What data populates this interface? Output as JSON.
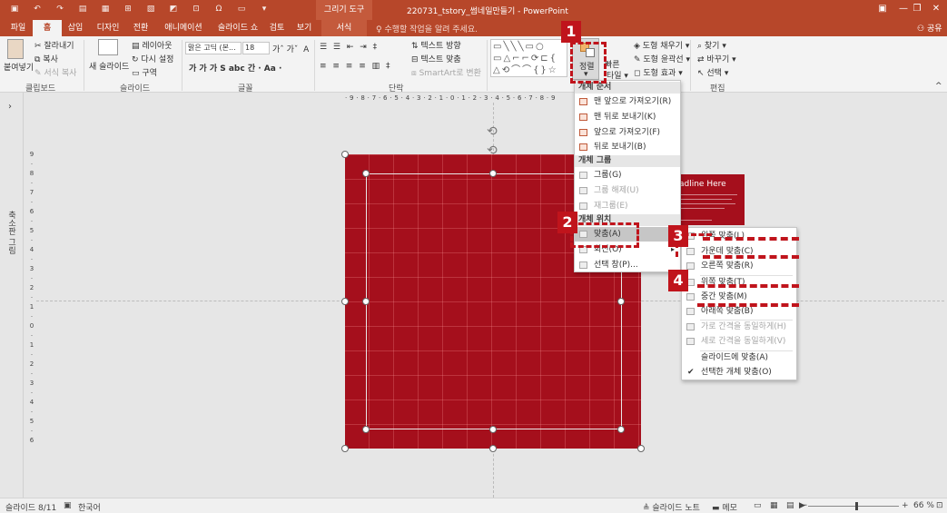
{
  "titlebar": {
    "context_tab": "그리기 도구",
    "doc_title": "220731_tstory_썸네일만들기 - PowerPoint",
    "qat_icons": [
      "save-icon",
      "undo-icon",
      "redo-icon",
      "slideshow-icon",
      "grid-icon",
      "table-icon",
      "picture-icon",
      "shape-icon",
      "symbol-icon",
      "omega-icon",
      "textbox-icon",
      "more-icon"
    ]
  },
  "tabs": [
    "파일",
    "홈",
    "삽입",
    "디자인",
    "전환",
    "애니메이션",
    "슬라이드 쇼",
    "검토",
    "보기",
    "서식"
  ],
  "active_tab": "홈",
  "tell_me": "수행할 작업을 알려 주세요.",
  "share": "공유",
  "ribbon": {
    "clipboard": {
      "paste": "붙여넣기",
      "cut": "잘라내기",
      "copy": "복사",
      "format_painter": "서식 복사",
      "group": "클립보드"
    },
    "slides": {
      "new_slide": "새 슬라이드",
      "layout": "레이아웃",
      "reset": "다시 설정",
      "section": "구역",
      "group": "슬라이드"
    },
    "font": {
      "name": "맑은 고딕 (본...",
      "size": "18",
      "group": "글꼴",
      "styles": "가 가 가 S abc 간 · Aa ·"
    },
    "paragraph": {
      "text_direction": "텍스트 방향",
      "align_text": "텍스트 맞춤",
      "smartart": "SmartArt로 변환",
      "group": "단락"
    },
    "drawing": {
      "arrange": "정렬",
      "quick_styles": "빠른 스타일",
      "fill": "도형 채우기",
      "outline": "도형 윤곽선",
      "effects": "도형 효과"
    },
    "editing": {
      "find": "찾기",
      "replace": "바꾸기",
      "select": "선택",
      "group": "편집"
    }
  },
  "side_panel_label": "축소판 그림",
  "rulers": {
    "horizontal": "· 9 · 8 · 7 · 6 · 5 · 4 · 3 · 2 · 1 · 0 · 1 · 2 · 3 · 4 · 5 · 6 · 7 · 8 · 9",
    "vertical": [
      "9",
      "8",
      "7",
      "6",
      "5",
      "4",
      "3",
      "2",
      "1",
      "0",
      "1",
      "2",
      "3",
      "4",
      "5",
      "6",
      "7",
      "8",
      "9"
    ]
  },
  "background_card": {
    "title": "adline Here"
  },
  "arrange_menu": {
    "order_header": "개체 순서",
    "order_items": [
      "맨 앞으로 가져오기(R)",
      "맨 뒤로 보내기(K)",
      "앞으로 가져오기(F)",
      "뒤로 보내기(B)"
    ],
    "group_header": "개체 그룹",
    "group_items": [
      {
        "label": "그룹(G)",
        "enabled": true
      },
      {
        "label": "그룹 해제(U)",
        "enabled": false
      },
      {
        "label": "재그룹(E)",
        "enabled": false
      }
    ],
    "position_header": "개체 위치",
    "position_items": [
      {
        "label": "맞춤(A)",
        "highlighted": true,
        "submenu": true
      },
      {
        "label": "회전(O)",
        "highlighted": false,
        "submenu": true
      },
      {
        "label": "선택 창(P)...",
        "highlighted": false,
        "submenu": false
      }
    ]
  },
  "align_submenu": {
    "items": [
      {
        "label": "왼쪽 맞춤(L)",
        "enabled": true
      },
      {
        "label": "가운데 맞춤(C)",
        "enabled": true
      },
      {
        "label": "오른쪽 맞춤(R)",
        "enabled": true
      },
      {
        "label": "위쪽 맞춤(T)",
        "enabled": true
      },
      {
        "label": "중간 맞춤(M)",
        "enabled": true
      },
      {
        "label": "아래쪽 맞춤(B)",
        "enabled": true
      },
      {
        "label": "가로 간격을 동일하게(H)",
        "enabled": false
      },
      {
        "label": "세로 간격을 동일하게(V)",
        "enabled": false
      },
      {
        "label": "슬라이드에 맞춤(A)",
        "enabled": true
      },
      {
        "label": "선택한 개체 맞춤(O)",
        "enabled": true,
        "checked": true
      }
    ]
  },
  "annotations": [
    "1",
    "2",
    "3",
    "4"
  ],
  "annotation_color": "#c0141c",
  "status": {
    "slide": "슬라이드 8/11",
    "language": "한국어",
    "notes": "슬라이드 노트",
    "comments": "메모",
    "zoom": "66 %",
    "zoom_minus": "−",
    "zoom_plus": "+"
  },
  "colors": {
    "accent": "#b7472a",
    "slide_fill": "#a50f1c"
  }
}
